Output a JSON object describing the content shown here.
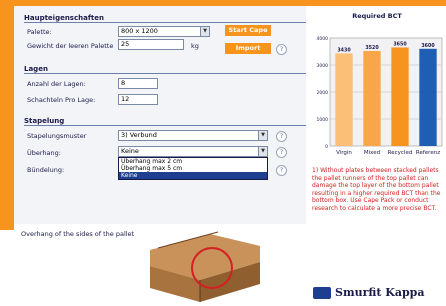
{
  "sections": {
    "haupt": "Haupteigenschaften",
    "lagen": "Lagen",
    "stapelung": "Stapelung"
  },
  "fields": {
    "palette_label": "Palette:",
    "palette_value": "800 x 1200",
    "gewicht_label": "Gewicht der leeren Palette",
    "gewicht_value": "25",
    "gewicht_unit": "kg",
    "anzahl_label": "Anzahl der Lagen:",
    "anzahl_value": "8",
    "schachteln_label": "Schachteln Pro Lage:",
    "schachteln_value": "12",
    "stapelmuster_label": "Stapelungsmuster",
    "stapelmuster_value": "3) Verbund",
    "ueberhang_label": "Überhang:",
    "ueberhang_value": "Keine",
    "buendelung_label": "Bündelung:"
  },
  "dropdown_options": [
    "Überhang max 2 cm",
    "Überhang max 5 cm",
    "Keine"
  ],
  "buttons": {
    "start": "Start Cape",
    "import": "Import",
    "help": "?"
  },
  "image_caption": "Overhang of the sides of the pallet",
  "chart_data": {
    "type": "bar",
    "title": "Required BCT",
    "categories": [
      "Virgin",
      "Mixed",
      "Recycled",
      "Referenz"
    ],
    "values": [
      3430,
      3520,
      3650,
      3600
    ],
    "data_labels": [
      "3430",
      "3520",
      "3650",
      "3600"
    ],
    "ylim": [
      0,
      4000
    ],
    "yticks": [
      0,
      1000,
      2000,
      3000,
      4000
    ],
    "colors": [
      "#fbbf78",
      "#f9a64a",
      "#f7941d",
      "#1e5fb4"
    ]
  },
  "note": "1) Without plates between stacked pallets the pallet runners of the top pallet can damage the top layer of the bottom pallet resulting in a higher required BCT than the bottom box. Use Cape Pack or conduct research to calculate a more precise BCT.",
  "logo": "Smurfit Kappa"
}
